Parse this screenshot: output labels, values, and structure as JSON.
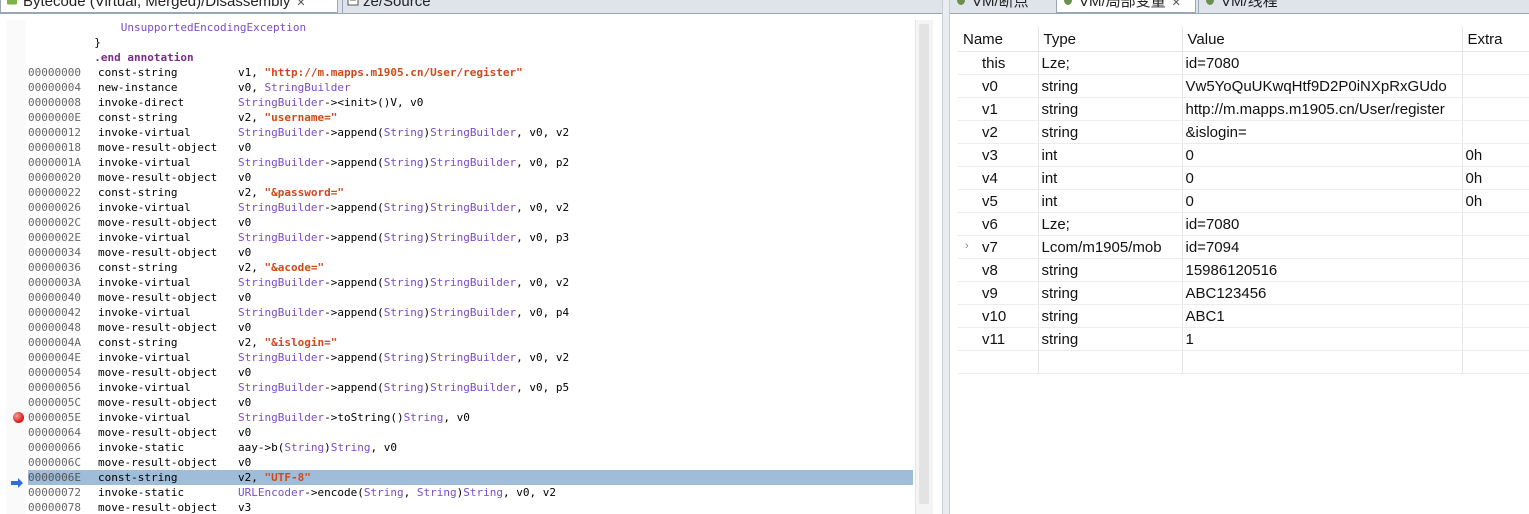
{
  "left_tabs": [
    {
      "label": "Bytecode (Virtual, Merged)/Disassembly",
      "close": "✕",
      "active": true
    },
    {
      "label": "ze/Source",
      "active": false
    }
  ],
  "right_tabs": [
    {
      "label": "VM/断点",
      "active": false
    },
    {
      "label": "VM/局部变量",
      "close": "✕",
      "active": true
    },
    {
      "label": "VM/线程",
      "active": false
    }
  ],
  "code": [
    {
      "full": "              UnsupportedEncodingException",
      "style": "cls"
    },
    {
      "full": "          }",
      "style": "plain"
    },
    {
      "full": "          .end annotation",
      "style": "kw"
    },
    {
      "addr": "00000000",
      "op": "const-string",
      "args": [
        {
          "t": "v1, "
        },
        {
          "t": "\"http://m.mapps.m1905.cn/User/register\"",
          "c": "str"
        }
      ]
    },
    {
      "addr": "00000004",
      "op": "new-instance",
      "args": [
        {
          "t": "v0, "
        },
        {
          "t": "StringBuilder",
          "c": "cls"
        }
      ]
    },
    {
      "addr": "00000008",
      "op": "invoke-direct",
      "args": [
        {
          "t": "StringBuilder",
          "c": "cls"
        },
        {
          "t": "-><init>()V, v0"
        }
      ]
    },
    {
      "addr": "0000000E",
      "op": "const-string",
      "args": [
        {
          "t": "v2, "
        },
        {
          "t": "\"username=\"",
          "c": "str"
        }
      ]
    },
    {
      "addr": "00000012",
      "op": "invoke-virtual",
      "args": [
        {
          "t": "StringBuilder",
          "c": "cls"
        },
        {
          "t": "->append("
        },
        {
          "t": "String",
          "c": "cls"
        },
        {
          "t": ")"
        },
        {
          "t": "StringBuilder",
          "c": "cls"
        },
        {
          "t": ", v0, v2"
        }
      ]
    },
    {
      "addr": "00000018",
      "op": "move-result-object",
      "args": [
        {
          "t": "v0"
        }
      ]
    },
    {
      "addr": "0000001A",
      "op": "invoke-virtual",
      "args": [
        {
          "t": "StringBuilder",
          "c": "cls"
        },
        {
          "t": "->append("
        },
        {
          "t": "String",
          "c": "cls"
        },
        {
          "t": ")"
        },
        {
          "t": "StringBuilder",
          "c": "cls"
        },
        {
          "t": ", v0, p2"
        }
      ]
    },
    {
      "addr": "00000020",
      "op": "move-result-object",
      "args": [
        {
          "t": "v0"
        }
      ]
    },
    {
      "addr": "00000022",
      "op": "const-string",
      "args": [
        {
          "t": "v2, "
        },
        {
          "t": "\"&password=\"",
          "c": "str"
        }
      ]
    },
    {
      "addr": "00000026",
      "op": "invoke-virtual",
      "args": [
        {
          "t": "StringBuilder",
          "c": "cls"
        },
        {
          "t": "->append("
        },
        {
          "t": "String",
          "c": "cls"
        },
        {
          "t": ")"
        },
        {
          "t": "StringBuilder",
          "c": "cls"
        },
        {
          "t": ", v0, v2"
        }
      ]
    },
    {
      "addr": "0000002C",
      "op": "move-result-object",
      "args": [
        {
          "t": "v0"
        }
      ]
    },
    {
      "addr": "0000002E",
      "op": "invoke-virtual",
      "args": [
        {
          "t": "StringBuilder",
          "c": "cls"
        },
        {
          "t": "->append("
        },
        {
          "t": "String",
          "c": "cls"
        },
        {
          "t": ")"
        },
        {
          "t": "StringBuilder",
          "c": "cls"
        },
        {
          "t": ", v0, p3"
        }
      ]
    },
    {
      "addr": "00000034",
      "op": "move-result-object",
      "args": [
        {
          "t": "v0"
        }
      ]
    },
    {
      "addr": "00000036",
      "op": "const-string",
      "args": [
        {
          "t": "v2, "
        },
        {
          "t": "\"&acode=\"",
          "c": "str"
        }
      ]
    },
    {
      "addr": "0000003A",
      "op": "invoke-virtual",
      "args": [
        {
          "t": "StringBuilder",
          "c": "cls"
        },
        {
          "t": "->append("
        },
        {
          "t": "String",
          "c": "cls"
        },
        {
          "t": ")"
        },
        {
          "t": "StringBuilder",
          "c": "cls"
        },
        {
          "t": ", v0, v2"
        }
      ]
    },
    {
      "addr": "00000040",
      "op": "move-result-object",
      "args": [
        {
          "t": "v0"
        }
      ]
    },
    {
      "addr": "00000042",
      "op": "invoke-virtual",
      "args": [
        {
          "t": "StringBuilder",
          "c": "cls"
        },
        {
          "t": "->append("
        },
        {
          "t": "String",
          "c": "cls"
        },
        {
          "t": ")"
        },
        {
          "t": "StringBuilder",
          "c": "cls"
        },
        {
          "t": ", v0, p4"
        }
      ]
    },
    {
      "addr": "00000048",
      "op": "move-result-object",
      "args": [
        {
          "t": "v0"
        }
      ]
    },
    {
      "addr": "0000004A",
      "op": "const-string",
      "args": [
        {
          "t": "v2, "
        },
        {
          "t": "\"&islogin=\"",
          "c": "str"
        }
      ]
    },
    {
      "addr": "0000004E",
      "op": "invoke-virtual",
      "args": [
        {
          "t": "StringBuilder",
          "c": "cls"
        },
        {
          "t": "->append("
        },
        {
          "t": "String",
          "c": "cls"
        },
        {
          "t": ")"
        },
        {
          "t": "StringBuilder",
          "c": "cls"
        },
        {
          "t": ", v0, v2"
        }
      ]
    },
    {
      "addr": "00000054",
      "op": "move-result-object",
      "args": [
        {
          "t": "v0"
        }
      ]
    },
    {
      "addr": "00000056",
      "op": "invoke-virtual",
      "args": [
        {
          "t": "StringBuilder",
          "c": "cls"
        },
        {
          "t": "->append("
        },
        {
          "t": "String",
          "c": "cls"
        },
        {
          "t": ")"
        },
        {
          "t": "StringBuilder",
          "c": "cls"
        },
        {
          "t": ", v0, p5"
        }
      ]
    },
    {
      "addr": "0000005C",
      "op": "move-result-object",
      "args": [
        {
          "t": "v0"
        }
      ]
    },
    {
      "addr": "0000005E",
      "op": "invoke-virtual",
      "args": [
        {
          "t": "StringBuilder",
          "c": "cls"
        },
        {
          "t": "->toString()"
        },
        {
          "t": "String",
          "c": "cls"
        },
        {
          "t": ", v0"
        }
      ],
      "breakpoint": true
    },
    {
      "addr": "00000064",
      "op": "move-result-object",
      "args": [
        {
          "t": "v0"
        }
      ]
    },
    {
      "addr": "00000066",
      "op": "invoke-static",
      "args": [
        {
          "t": "aay->b("
        },
        {
          "t": "String",
          "c": "cls"
        },
        {
          "t": ")"
        },
        {
          "t": "String",
          "c": "cls"
        },
        {
          "t": ", v0"
        }
      ]
    },
    {
      "addr": "0000006C",
      "op": "move-result-object",
      "args": [
        {
          "t": "v0"
        }
      ]
    },
    {
      "addr": "0000006E",
      "op": "const-string",
      "args": [
        {
          "t": "v2, "
        },
        {
          "t": "\"UTF-8\"",
          "c": "str"
        }
      ],
      "current": true
    },
    {
      "addr": "00000072",
      "op": "invoke-static",
      "args": [
        {
          "t": "URLEncoder",
          "c": "cls"
        },
        {
          "t": "->encode("
        },
        {
          "t": "String",
          "c": "cls"
        },
        {
          "t": ", "
        },
        {
          "t": "String",
          "c": "cls"
        },
        {
          "t": ")"
        },
        {
          "t": "String",
          "c": "cls"
        },
        {
          "t": ", v0, v2"
        }
      ]
    },
    {
      "addr": "00000078",
      "op": "move-result-object",
      "args": [
        {
          "t": "v3"
        }
      ]
    }
  ],
  "variables": {
    "headers": [
      "Name",
      "Type",
      "Value",
      "Extra"
    ],
    "rows": [
      {
        "name": "this",
        "type": "Lze;",
        "value": "id=7080",
        "extra": ""
      },
      {
        "name": "v0",
        "type": "string",
        "value": "Vw5YoQuUKwqHtf9D2P0iNXpRxGUdo",
        "extra": ""
      },
      {
        "name": "v1",
        "type": "string",
        "value": "http://m.mapps.m1905.cn/User/register",
        "extra": ""
      },
      {
        "name": "v2",
        "type": "string",
        "value": "&islogin=",
        "extra": ""
      },
      {
        "name": "v3",
        "type": "int",
        "value": "0",
        "extra": "0h"
      },
      {
        "name": "v4",
        "type": "int",
        "value": "0",
        "extra": "0h"
      },
      {
        "name": "v5",
        "type": "int",
        "value": "0",
        "extra": "0h"
      },
      {
        "name": "v6",
        "type": "Lze;",
        "value": "id=7080",
        "extra": ""
      },
      {
        "name": "v7",
        "type": "Lcom/m1905/mob",
        "value": "id=7094",
        "extra": "",
        "expandable": true
      },
      {
        "name": "v8",
        "type": "string",
        "value": "15986120516",
        "extra": ""
      },
      {
        "name": "v9",
        "type": "string",
        "value": "ABC123456",
        "extra": ""
      },
      {
        "name": "v10",
        "type": "string",
        "value": "ABC1",
        "extra": ""
      },
      {
        "name": "v11",
        "type": "string",
        "value": "1",
        "extra": ""
      }
    ]
  },
  "icons": {
    "bytecode_tab": "android-icon",
    "vm_tab": "bug-debug-icon",
    "breakpoint": "breakpoint-icon",
    "current_line": "execution-arrow-icon"
  },
  "colors": {
    "class_ref": "#7b4bc9",
    "string_literal": "#d0491b",
    "directive": "#7b2b8a",
    "current_line_bg": "#9fbcd9",
    "breakpoint": "#d41414"
  }
}
